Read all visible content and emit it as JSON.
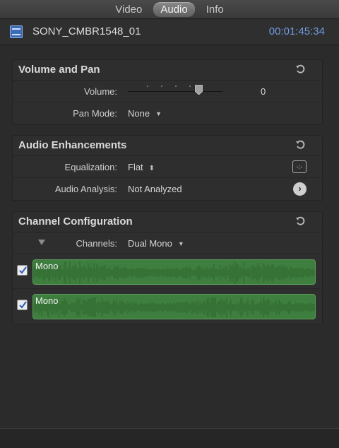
{
  "tabs": [
    {
      "label": "Video",
      "active": false
    },
    {
      "label": "Audio",
      "active": true
    },
    {
      "label": "Info",
      "active": false
    }
  ],
  "header": {
    "clip_name": "SONY_CMBR1548_01",
    "timecode": "00:01:45:34",
    "icon": "clip-filmstrip-icon"
  },
  "volume_pan": {
    "title": "Volume and Pan",
    "volume_label": "Volume:",
    "volume_value": "0",
    "pan_mode_label": "Pan Mode:",
    "pan_mode_value": "None"
  },
  "audio_enhancements": {
    "title": "Audio Enhancements",
    "equalization_label": "Equalization:",
    "equalization_value": "Flat",
    "analysis_label": "Audio Analysis:",
    "analysis_value": "Not Analyzed"
  },
  "channel_config": {
    "title": "Channel Configuration",
    "channels_label": "Channels:",
    "channels_value": "Dual Mono",
    "channels": [
      {
        "label": "Mono",
        "checked": true
      },
      {
        "label": "Mono",
        "checked": true
      }
    ]
  },
  "colors": {
    "accent_timecode": "#6f9be0",
    "waveform_green": "#3e7e3e"
  }
}
